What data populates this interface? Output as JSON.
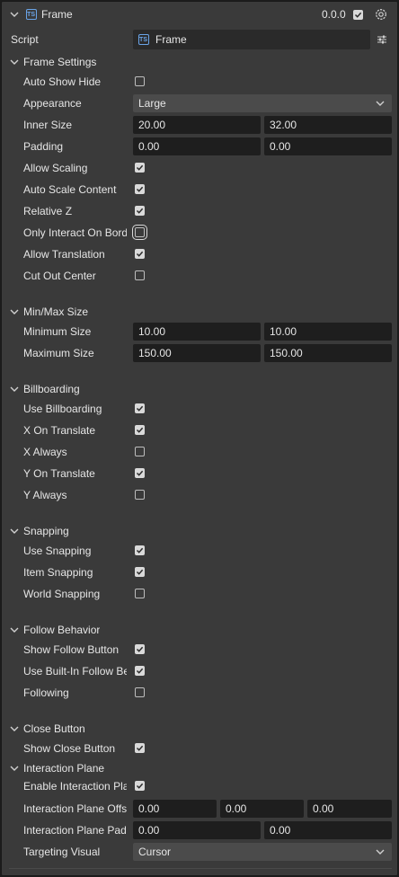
{
  "header": {
    "title": "Frame",
    "ts_badge": "TS",
    "version": "0.0.0",
    "enabled": true
  },
  "script": {
    "label": "Script",
    "value": "Frame",
    "ts_badge": "TS"
  },
  "sections": {
    "frame_settings": {
      "title": "Frame Settings",
      "auto_show_hide": {
        "label": "Auto Show Hide",
        "checked": false
      },
      "appearance": {
        "label": "Appearance",
        "value": "Large"
      },
      "inner_size": {
        "label": "Inner Size",
        "x": "20.00",
        "y": "32.00"
      },
      "padding": {
        "label": "Padding",
        "x": "0.00",
        "y": "0.00"
      },
      "allow_scaling": {
        "label": "Allow Scaling",
        "checked": true
      },
      "auto_scale_content": {
        "label": "Auto Scale Content",
        "checked": true
      },
      "relative_z": {
        "label": "Relative Z",
        "checked": true
      },
      "only_interact_on_border": {
        "label": "Only Interact On Border",
        "checked": false
      },
      "allow_translation": {
        "label": "Allow Translation",
        "checked": true
      },
      "cut_out_center": {
        "label": "Cut Out Center",
        "checked": false
      }
    },
    "min_max_size": {
      "title": "Min/Max Size",
      "minimum_size": {
        "label": "Minimum Size",
        "x": "10.00",
        "y": "10.00"
      },
      "maximum_size": {
        "label": "Maximum Size",
        "x": "150.00",
        "y": "150.00"
      }
    },
    "billboarding": {
      "title": "Billboarding",
      "use_billboarding": {
        "label": "Use Billboarding",
        "checked": true
      },
      "x_on_translate": {
        "label": "X On Translate",
        "checked": true
      },
      "x_always": {
        "label": "X Always",
        "checked": false
      },
      "y_on_translate": {
        "label": "Y On Translate",
        "checked": true
      },
      "y_always": {
        "label": "Y Always",
        "checked": false
      }
    },
    "snapping": {
      "title": "Snapping",
      "use_snapping": {
        "label": "Use Snapping",
        "checked": true
      },
      "item_snapping": {
        "label": "Item Snapping",
        "checked": true
      },
      "world_snapping": {
        "label": "World Snapping",
        "checked": false
      }
    },
    "follow_behavior": {
      "title": "Follow Behavior",
      "show_follow_button": {
        "label": "Show Follow Button",
        "checked": true
      },
      "use_builtin_follow": {
        "label": "Use Built-In Follow Behavior",
        "checked": true
      },
      "following": {
        "label": "Following",
        "checked": false
      }
    },
    "close_button": {
      "title": "Close Button",
      "show_close_button": {
        "label": "Show Close Button",
        "checked": true
      }
    },
    "interaction_plane": {
      "title": "Interaction Plane",
      "enable_interaction_plane": {
        "label": "Enable Interaction Plane",
        "checked": true
      },
      "interaction_plane_offset": {
        "label": "Interaction Plane Offset",
        "x": "0.00",
        "y": "0.00",
        "z": "0.00"
      },
      "interaction_plane_padding": {
        "label": "Interaction Plane Padding",
        "x": "0.00",
        "y": "0.00"
      },
      "targeting_visual": {
        "label": "Targeting Visual",
        "value": "Cursor"
      }
    }
  }
}
